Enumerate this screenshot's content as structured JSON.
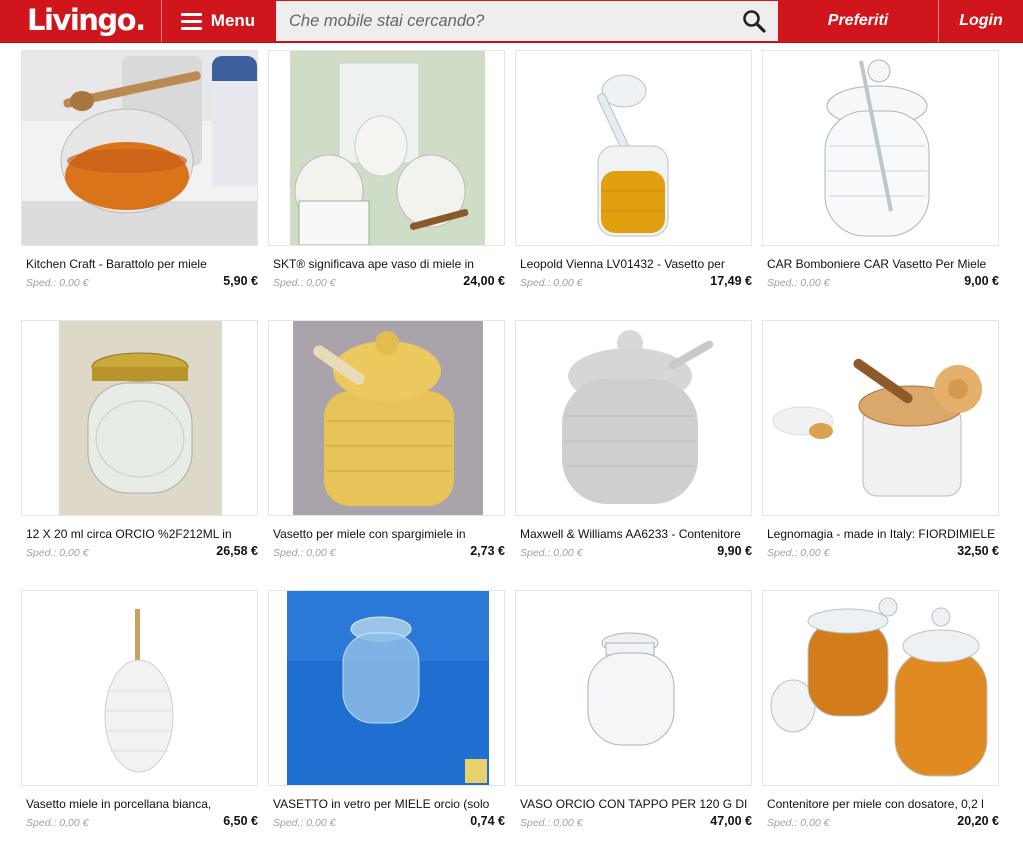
{
  "header": {
    "logo": "Livingo.",
    "menu_label": "Menu",
    "search_placeholder": "Che mobile stai cercando?",
    "favorites_label": "Preferiti",
    "login_label": "Login"
  },
  "colors": {
    "brand": "#d0161c",
    "search_bg": "#eeeeee",
    "shipping": "#a0a0a0"
  },
  "products": [
    {
      "title": "Kitchen Craft - Barattolo per miele",
      "shipping": "Sped.: 0,00 €",
      "price": "5,90 €",
      "image": "honey-jar-with-dipper"
    },
    {
      "title": "SKT® significava ape vaso di miele in",
      "shipping": "Sped.: 0,00 €",
      "price": "24,00 €",
      "image": "ceramic-beehive-pots-gift-box"
    },
    {
      "title": "Leopold Vienna LV01432 - Vasetto per",
      "shipping": "Sped.: 0,00 €",
      "price": "17,49 €",
      "image": "glass-honey-jar-with-dipper-lid"
    },
    {
      "title": "CAR Bomboniere CAR Vasetto Per Miele",
      "shipping": "Sped.: 0,00 €",
      "price": "9,00 €",
      "image": "empty-glass-beehive-jar"
    },
    {
      "title": "12 X 20 ml circa ORCIO %2F212ML in",
      "shipping": "Sped.: 0,00 €",
      "price": "26,58 €",
      "image": "glass-jar-gold-lid"
    },
    {
      "title": "Vasetto per miele con spargimiele in",
      "shipping": "Sped.: 0,00 €",
      "price": "2,73 €",
      "image": "yellow-ceramic-beehive-pot"
    },
    {
      "title": "Maxwell & Williams AA6233 - Contenitore",
      "shipping": "Sped.: 0,00 €",
      "price": "9,90 €",
      "image": "grey-ceramic-honey-pot"
    },
    {
      "title": "Legnomagia - made in Italy: FIORDIMIELE",
      "shipping": "Sped.: 0,00 €",
      "price": "32,50 €",
      "image": "glass-jar-bamboo-lid-flower"
    },
    {
      "title": "Vasetto miele in porcellana bianca,",
      "shipping": "Sped.: 0,00 €",
      "price": "6,50 €",
      "image": "white-porcelain-honey-pot"
    },
    {
      "title": "VASETTO in vetro per MIELE orcio (solo",
      "shipping": "Sped.: 0,00 €",
      "price": "0,74 €",
      "image": "glass-jar-blue-background"
    },
    {
      "title": "VASO ORCIO CON TAPPO PER 120 G DI",
      "shipping": "Sped.: 0,00 €",
      "price": "47,00 €",
      "image": "small-glass-orcio-jar"
    },
    {
      "title": "Contenitore per miele con dosatore, 0,2 l",
      "shipping": "Sped.: 0,00 €",
      "price": "20,20 €",
      "image": "two-glass-honey-jars"
    }
  ]
}
